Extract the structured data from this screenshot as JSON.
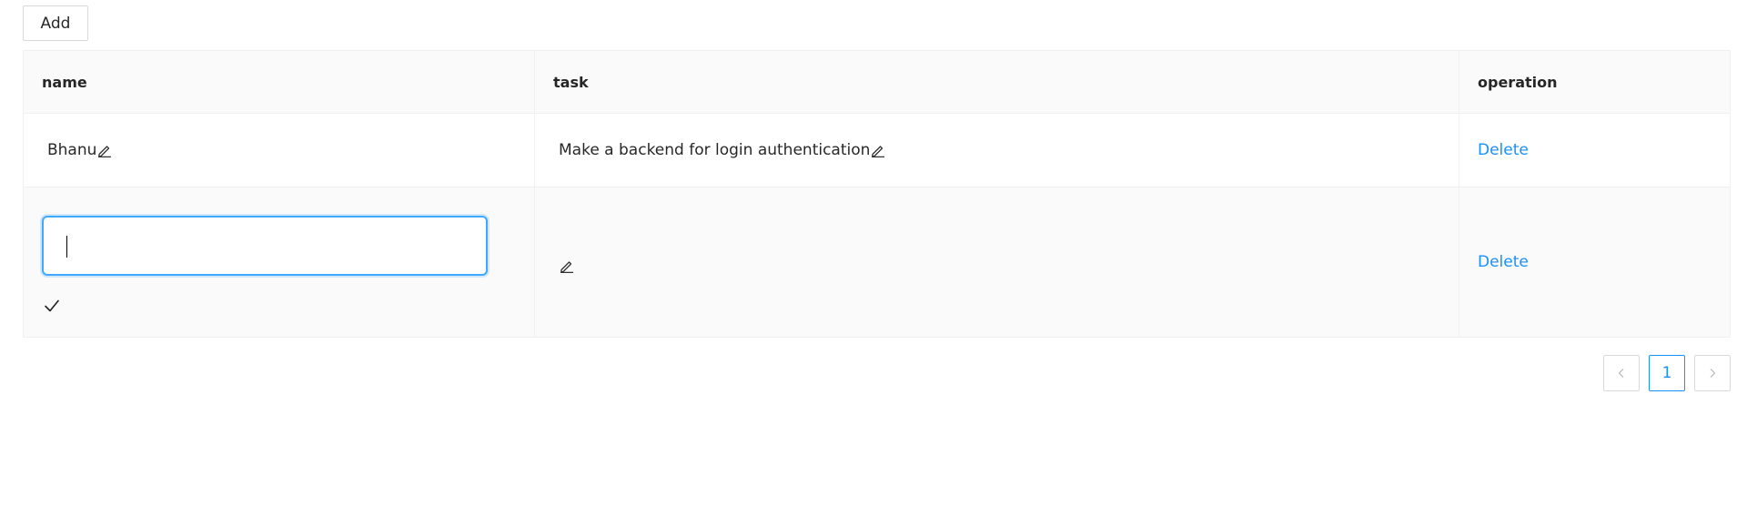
{
  "toolbar": {
    "add_label": "Add"
  },
  "table": {
    "columns": [
      "name",
      "task",
      "operation"
    ],
    "rows": [
      {
        "name": "Bhanu",
        "task": "Make a backend for login authentication",
        "operation": "Delete"
      },
      {
        "name": "",
        "task": "",
        "operation": "Delete",
        "editing": "name"
      }
    ]
  },
  "pagination": {
    "current_page": "1",
    "prev_icon": "chevron-left-icon",
    "next_icon": "chevron-right-icon"
  },
  "colors": {
    "accent": "#1890ff",
    "input_focus": "#40a9ff",
    "header_bg": "#fafafa",
    "border": "#f0f0f0"
  },
  "icons": {
    "edit": "edit-pencil-icon",
    "confirm": "check-icon"
  }
}
